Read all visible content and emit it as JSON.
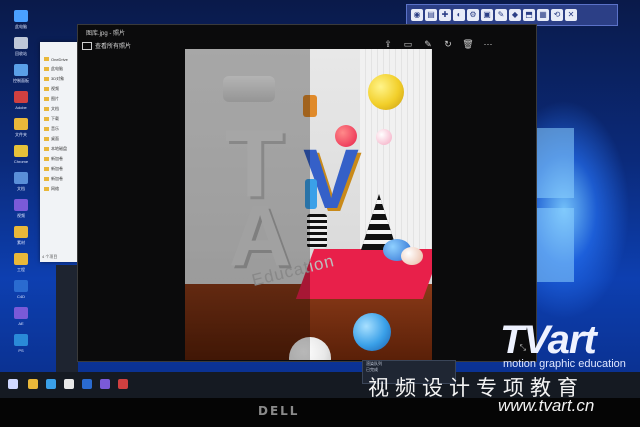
{
  "viewer": {
    "title": "图库.jpg - 照片",
    "back_label": "查看所有照片",
    "toolbar": [
      {
        "icon": "share-icon",
        "glyph": "⇪"
      },
      {
        "icon": "zoom-icon",
        "glyph": "▭"
      },
      {
        "icon": "edit-icon",
        "glyph": "✎"
      },
      {
        "icon": "rotate-icon",
        "glyph": "↻"
      },
      {
        "icon": "delete-icon",
        "glyph": "🗑"
      },
      {
        "icon": "more-icon",
        "glyph": "⋯"
      }
    ],
    "expand_glyph": "⤡"
  },
  "photo": {
    "letters": [
      "T",
      "V",
      "A"
    ],
    "caption": "Education"
  },
  "explorer": {
    "items": [
      "OneDrive",
      "此电脑",
      "3D对象",
      "视频",
      "图片",
      "文档",
      "下载",
      "音乐",
      "桌面",
      "本地磁盘",
      "新加卷",
      "新加卷",
      "新加卷",
      "网络"
    ],
    "status": "4 个项目"
  },
  "desktop_icons": [
    {
      "label": "此电脑",
      "color": "#4aa0ff"
    },
    {
      "label": "回收站",
      "color": "#bfc8d8"
    },
    {
      "label": "控制面板",
      "color": "#5aa0e8"
    },
    {
      "label": "Adobe",
      "color": "#d04040"
    },
    {
      "label": "文件夹",
      "color": "#e9b83a"
    },
    {
      "label": "Chrome",
      "color": "#e6c23a"
    },
    {
      "label": "文档",
      "color": "#5a8fd8"
    },
    {
      "label": "视频",
      "color": "#7a5ad8"
    },
    {
      "label": "素材",
      "color": "#e9b83a"
    },
    {
      "label": "工程",
      "color": "#e9b83a"
    },
    {
      "label": "C4D",
      "color": "#2a6bd0"
    },
    {
      "label": "AE",
      "color": "#7a5ad8"
    },
    {
      "label": "PS",
      "color": "#2a8ad8"
    }
  ],
  "mini_window": {
    "lines": [
      "渲染队列",
      "已完成"
    ]
  },
  "watermark": {
    "logo": "TVart",
    "subtitle": "motion graphic education",
    "chinese": "视频设计专项教育",
    "url": "www.tvart.cn"
  },
  "monitor_brand": "DELL",
  "colors": {
    "accent_red": "#e8204a",
    "ball_yellow": "#f2cf2a",
    "ball_blue": "#3aa0e8",
    "desktop_blue": "#0d3fb0"
  }
}
